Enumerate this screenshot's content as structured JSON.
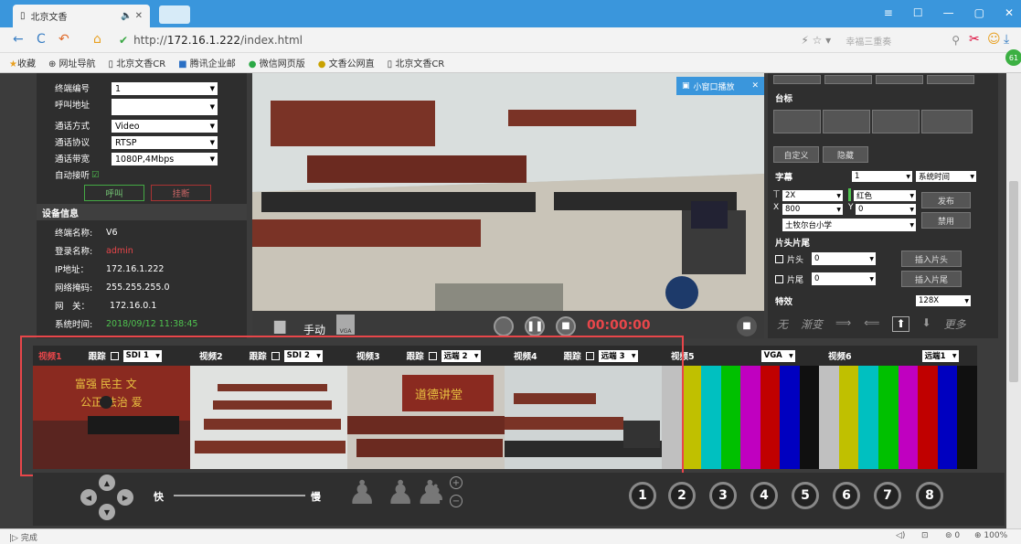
{
  "browser": {
    "tab_title": "北京文香",
    "url_prefix": "http://",
    "url_host": "172.16.1.222",
    "url_path": "/index.html",
    "search_placeholder": "幸福三重奏",
    "bookmarks": [
      "收藏",
      "网址导航",
      "北京文香CR",
      "腾讯企业邮",
      "微信网页版",
      "文香公网直",
      "北京文香CR"
    ],
    "status_text": "完成",
    "zoom": "100%",
    "download_count": "0",
    "badge": "61"
  },
  "left": {
    "fields": [
      {
        "label": "终端编号",
        "value": "1"
      },
      {
        "label": "呼叫地址",
        "value": ""
      },
      {
        "label": "通话方式",
        "value": "Video"
      },
      {
        "label": "通话协议",
        "value": "RTSP"
      },
      {
        "label": "通话带宽",
        "value": "1080P,4Mbps"
      }
    ],
    "auto_answer": "自动接听",
    "call_btn": "呼叫",
    "hangup_btn": "挂断",
    "device_header": "设备信息",
    "info": [
      {
        "label": "终端名称:",
        "value": "V6"
      },
      {
        "label": "登录名称:",
        "value": "admin"
      },
      {
        "label": "IP地址：",
        "value": "172.16.1.222"
      },
      {
        "label": "网络掩码:",
        "value": "255.255.255.0"
      },
      {
        "label": "网　关：",
        "value": "172.16.0.1"
      },
      {
        "label": "系统时间:",
        "value": "2018/09/12 11:38:45"
      }
    ]
  },
  "video": {
    "pip_label": "小窗口播放",
    "mode_label": "手动",
    "vga_label": "VGA",
    "timer": "00:00:00"
  },
  "right": {
    "logo_label": "台标",
    "custom_btn": "自定义",
    "hide_btn": "隐藏",
    "subtitle_label": "字幕",
    "subtitle_index": "1",
    "subtitle_mode": "系统时间",
    "size": "2X",
    "color": "红色",
    "x_val": "800",
    "y_val": "0",
    "text_val": "土牧尔台小学",
    "publish_btn": "发布",
    "disable_btn": "禁用",
    "clip_label": "片头片尾",
    "head_label": "片头",
    "head_val": "0",
    "tail_label": "片尾",
    "tail_val": "0",
    "insert_head_btn": "插入片头",
    "insert_tail_btn": "插入片尾",
    "effect_label": "特效",
    "effect_speed": "128X",
    "effects": [
      "无",
      "渐变",
      "",
      "",
      "",
      "",
      "更多"
    ]
  },
  "channels": [
    {
      "name": "视频1",
      "track": "跟踪",
      "src": "SDI 1"
    },
    {
      "name": "视频2",
      "track": "跟踪",
      "src": "SDI 2"
    },
    {
      "name": "视频3",
      "track": "跟踪",
      "src": "远端 2"
    },
    {
      "name": "视频4",
      "track": "跟踪",
      "src": "远端 3"
    },
    {
      "name": "视频5",
      "track": "",
      "src": "VGA"
    },
    {
      "name": "视频6",
      "track": "",
      "src": "远端1"
    }
  ],
  "bottom": {
    "fast": "快",
    "slow": "慢",
    "presets": [
      "1",
      "2",
      "3",
      "4",
      "5",
      "6",
      "7",
      "8"
    ]
  },
  "colors": {
    "accent": "#e8464a",
    "green": "#4fc34f",
    "titlebar": "#3a96dc"
  }
}
